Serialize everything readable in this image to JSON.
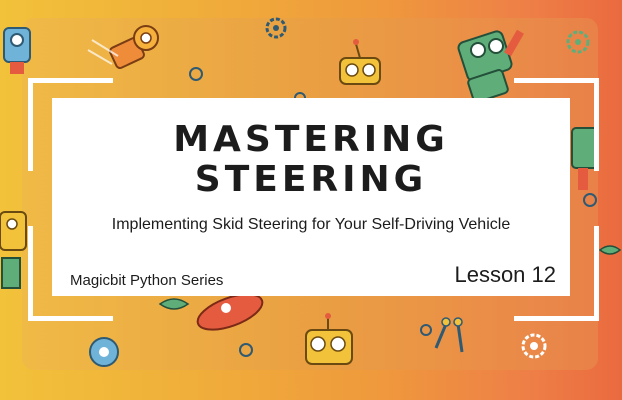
{
  "banner": {
    "title_line1": "Mastering",
    "title_line2": "Steering",
    "subtitle": "Implementing Skid Steering for Your Self-Driving Vehicle",
    "series": "Magicbit Python Series",
    "lesson": "Lesson 12"
  },
  "colors": {
    "background_left": "#f2c23a",
    "background_right": "#ea6a3f",
    "card": "#ffffff",
    "text": "#1c1c1c",
    "robot_green": "#5fae7a",
    "robot_blue": "#6fb3d8",
    "robot_red": "#d9573a"
  },
  "decorations": [
    "robot-icon",
    "gear-icon",
    "antenna-icon",
    "propeller-icon"
  ]
}
